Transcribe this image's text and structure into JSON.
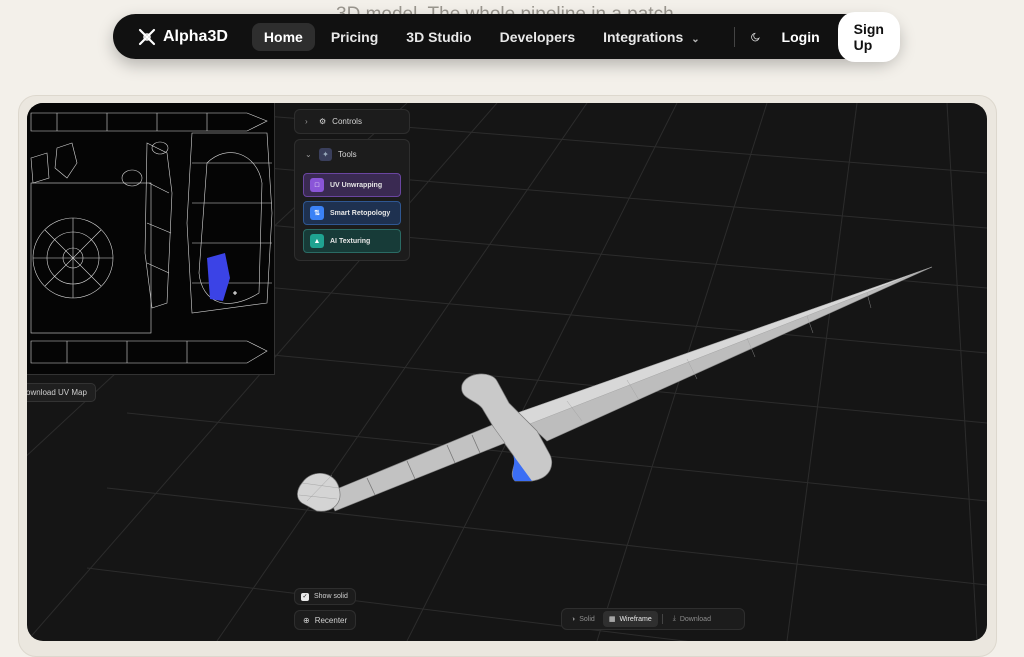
{
  "hero": {
    "behind_text": "3D model. The whole pipeline in a patch"
  },
  "nav": {
    "brand": "Alpha3D",
    "items": [
      {
        "label": "Home",
        "active": true
      },
      {
        "label": "Pricing"
      },
      {
        "label": "3D Studio"
      },
      {
        "label": "Developers"
      },
      {
        "label": "Integrations",
        "has_dropdown": true
      }
    ],
    "theme_toggle_icon": "moon-icon",
    "login": "Login",
    "signup": "Sign Up"
  },
  "viewer": {
    "uv_map": {
      "download_label": "ownload UV Map"
    },
    "controls": {
      "label": "Controls",
      "icon": "gear-icon"
    },
    "tools": {
      "label": "Tools",
      "icon": "wand-icon",
      "items": [
        {
          "label": "UV Unwrapping",
          "icon": "uv-icon",
          "color": "#8a55d8"
        },
        {
          "label": "Smart Retopology",
          "icon": "retopology-icon",
          "color": "#3b82f6"
        },
        {
          "label": "AI Texturing",
          "icon": "texture-icon",
          "color": "#1fa391"
        }
      ]
    },
    "show_solid": {
      "label": "Show solid",
      "checked": true
    },
    "recenter": {
      "label": "Recenter"
    },
    "modes": {
      "solid": "Solid",
      "wireframe": "Wireframe",
      "download": "Download",
      "active": "Wireframe"
    }
  },
  "colors": {
    "nav_bg": "#111111",
    "viewer_bg": "#151515",
    "page_bg": "#f3f0ea",
    "highlight": "#3b6ef5"
  }
}
